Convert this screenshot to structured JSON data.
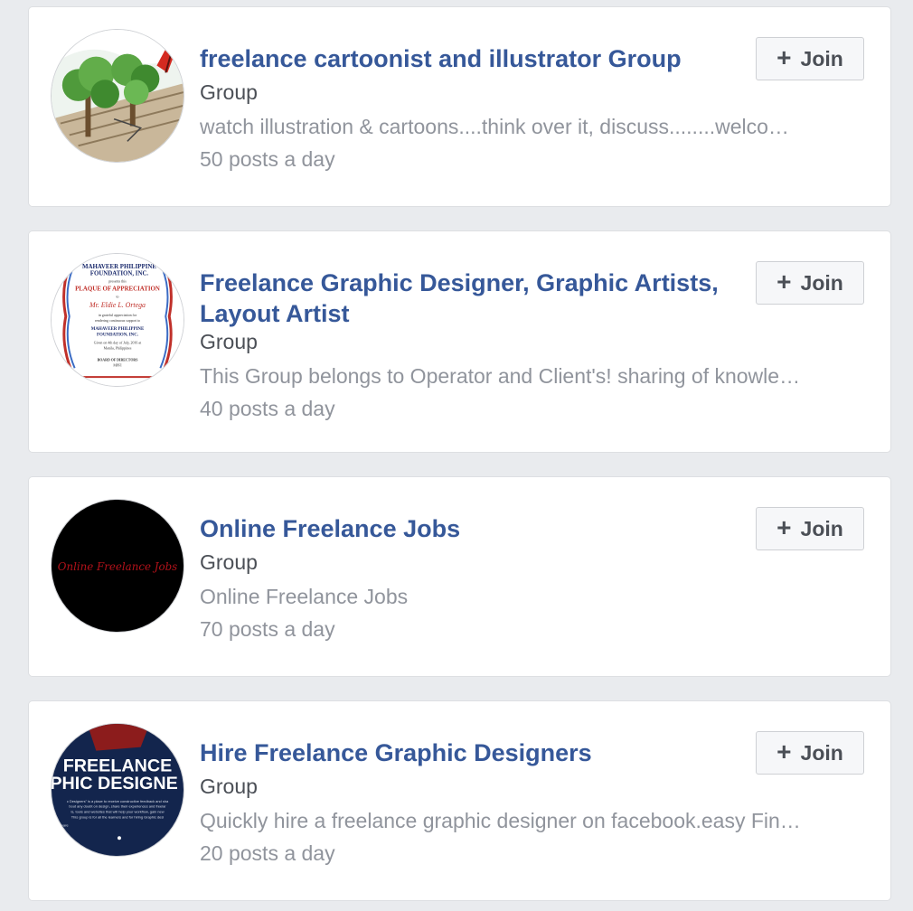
{
  "groups": [
    {
      "title": "freelance cartoonist and illustrator Group",
      "type": "Group",
      "description": "watch illustration & cartoons....think over it, discuss........welco…",
      "activity": "50 posts a day",
      "join_label": "Join",
      "avatar_icon": "cartoon-trees-avatar"
    },
    {
      "title": "Freelance Graphic Designer, Graphic Artists, Layout Artist",
      "type": "Group",
      "description": "This Group belongs to Operator and Client's! sharing of knowle…",
      "activity": "40 posts a day",
      "join_label": "Join",
      "avatar_icon": "certificate-avatar",
      "avatar_text": {
        "org_line1": "MAHAVEER PHILIPPINE",
        "org_line2": "FOUNDATION, INC.",
        "presents": "presents this",
        "plaque": "PLAQUE OF APPRECIATION",
        "to": "to",
        "name": "Mr. Eldie L. Ortega",
        "in_grateful": "in grateful appreciation for",
        "rendering": "rendering continuous support to",
        "foot_org1": "MAHAVEER PHILIPPINE",
        "foot_org2": "FOUNDATION, INC.",
        "given1": "Given on 4th day of July, 2016 at",
        "given2": "Manila, Philippines",
        "board": "BOARD OF DIRECTORS",
        "mpfi": "MPFI"
      }
    },
    {
      "title": "Online Freelance Jobs",
      "type": "Group",
      "description": "Online Freelance Jobs",
      "activity": "70 posts a day",
      "join_label": "Join",
      "avatar_icon": "online-freelance-jobs-avatar",
      "avatar_text": "Online Freelance Jobs"
    },
    {
      "title": "Hire Freelance Graphic Designers",
      "type": "Group",
      "description": "Quickly hire a freelance graphic designer on facebook.easy Fin…",
      "activity": "20 posts a day",
      "join_label": "Join",
      "avatar_icon": "freelance-graphic-designers-avatar",
      "avatar_text": {
        "line1": "FREELANCE",
        "line2": "PHIC DESIGNE",
        "body1": "c Designers\" is a place to receive constructive feedback and sha",
        "body2": "bout any doubt on design, share their experiences and freelar",
        "body3": "ls, tools and websites that will help your workflow, gain new",
        "body4": "This group is for all the learners and for hiring Graphic desi",
        "body5": "aware"
      }
    }
  ],
  "colors": {
    "page_bg": "#e9ebee",
    "link": "#365899",
    "secondary_text": "#90949c",
    "primary_text": "#4b4f56"
  }
}
